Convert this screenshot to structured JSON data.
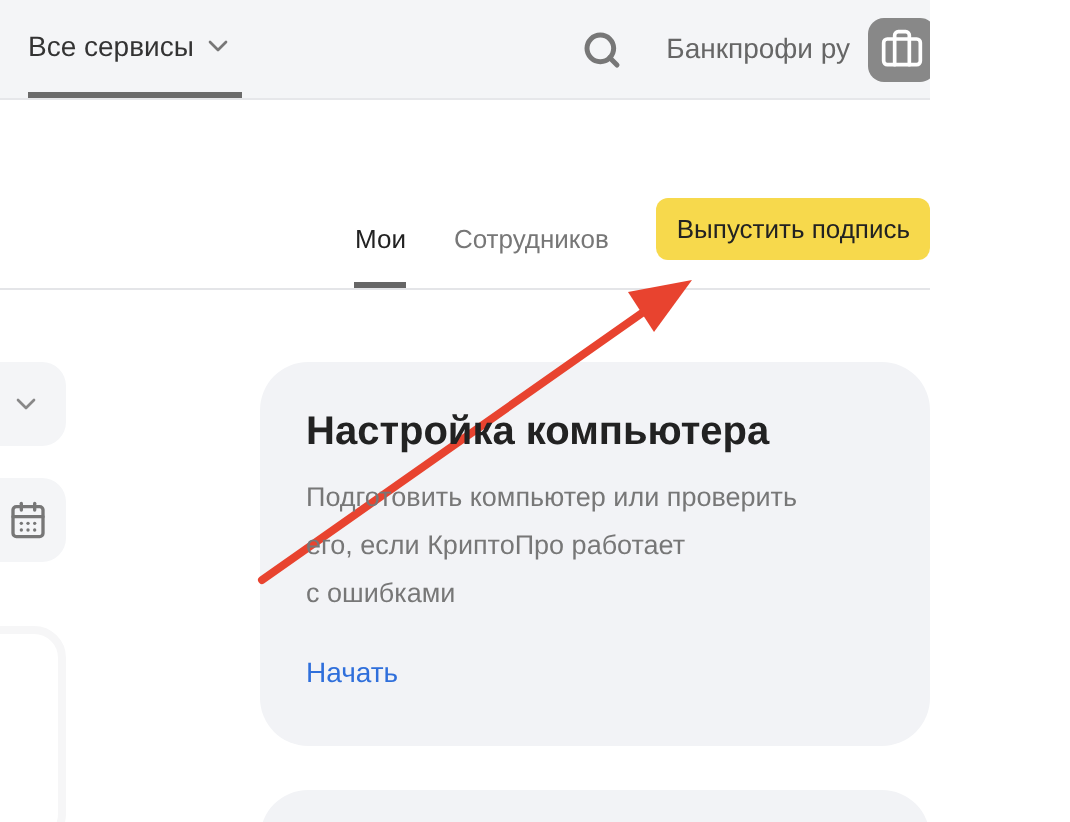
{
  "header": {
    "nav": [
      {
        "label": "Все сервисы",
        "selected": true
      }
    ],
    "account_name": "Банкпрофи ру"
  },
  "tabs": [
    {
      "label": "Мои",
      "selected": true
    },
    {
      "label": "Сотрудников",
      "selected": false
    }
  ],
  "issue_button": "Выпустить подпись",
  "card": {
    "title": "Настройка компьютера",
    "description": "Подготовить компьютер или проверить его, если КриптоПро работает с ошибками",
    "action": "Начать"
  }
}
